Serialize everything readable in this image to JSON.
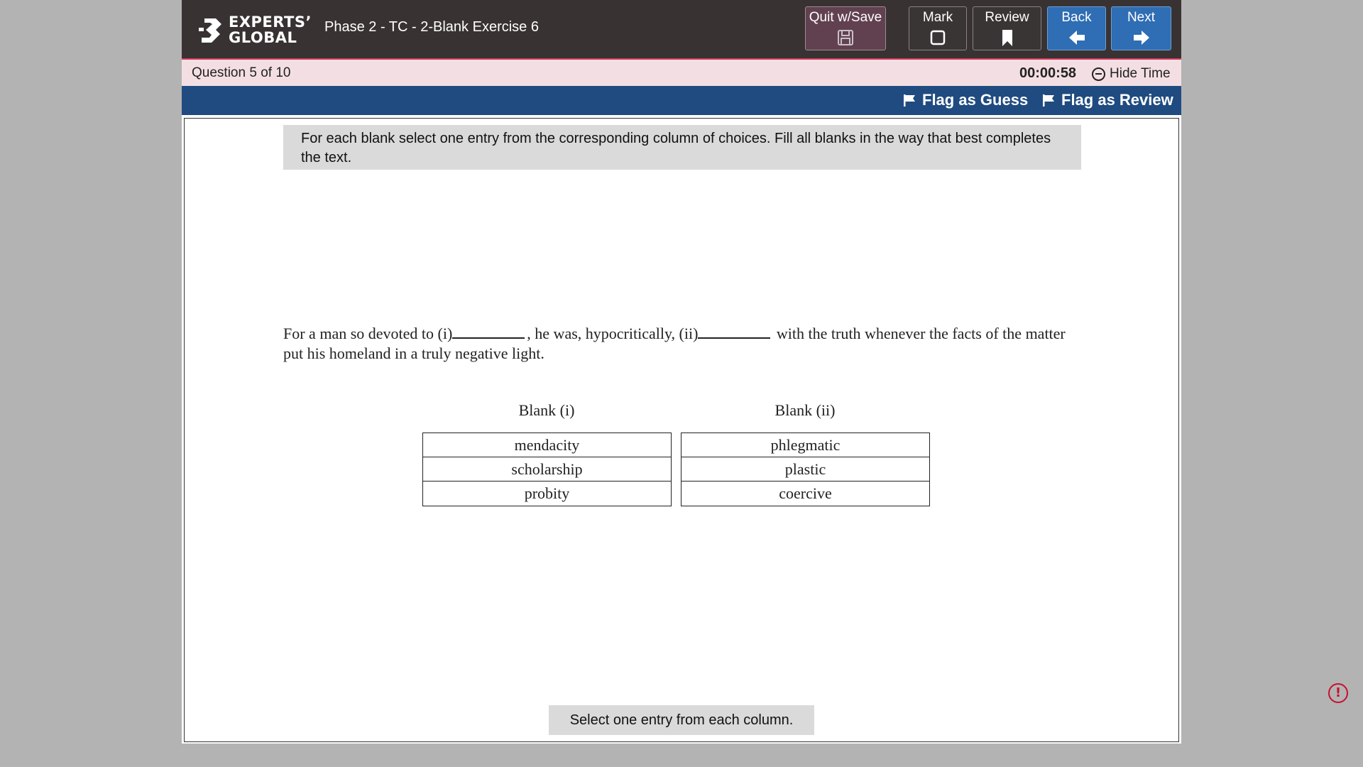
{
  "header": {
    "logo_line1": "EXPERTS’",
    "logo_line2": "GLOBAL",
    "exam_title": "Phase 2 - TC - 2-Blank Exercise 6",
    "buttons": {
      "quit": {
        "label": "Quit w/Save",
        "icon": "save-icon"
      },
      "mark": {
        "label": "Mark",
        "icon": "checkbox-icon"
      },
      "review": {
        "label": "Review",
        "icon": "bookmark-icon"
      },
      "back": {
        "label": "Back",
        "icon": "arrow-left-icon"
      },
      "next": {
        "label": "Next",
        "icon": "arrow-right-icon"
      }
    }
  },
  "question_bar": {
    "prefix": "Question",
    "current": "5",
    "of": "of",
    "total": "10",
    "timer": "00:00:58",
    "hide_time_label": "Hide Time"
  },
  "flags": {
    "guess_label": "Flag as Guess",
    "review_label": "Flag as Review"
  },
  "question": {
    "instructions": "For each blank select one entry from the corresponding column of choices. Fill all blanks in the way that best completes the text.",
    "passage_part1": "For a man so devoted to (i)",
    "passage_part2": ", he was, hypocritically, (ii)",
    "passage_part3": " with the truth whenever the facts of the matter put his homeland in a truly negative light.",
    "blank1": {
      "heading": "Blank (i)",
      "choices": [
        "mendacity",
        "scholarship",
        "probity"
      ]
    },
    "blank2": {
      "heading": "Blank (ii)",
      "choices": [
        "phlegmatic",
        "plastic",
        "coercive"
      ]
    },
    "status": "Select one entry from each column."
  },
  "colors": {
    "header_bg": "#383332",
    "question_bar_bg": "#f3dfe3",
    "question_bar_accent": "#d03a5a",
    "flag_bar_bg": "#1f4b80",
    "nav_blue": "#2f6db4",
    "quit_bg": "#614150",
    "alert": "#c8102e"
  }
}
